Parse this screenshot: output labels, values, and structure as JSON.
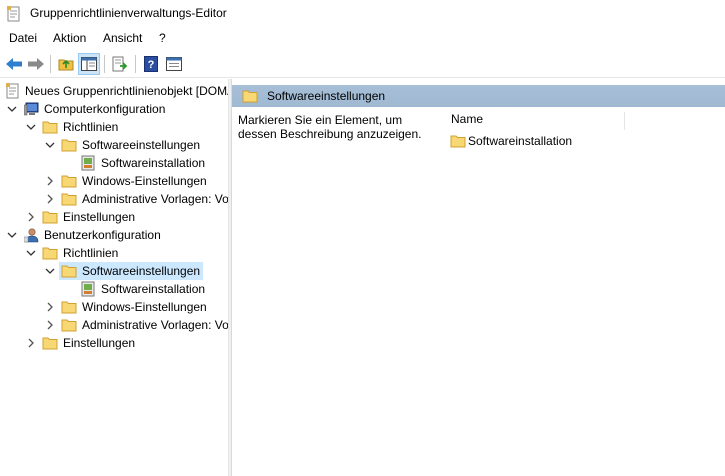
{
  "window": {
    "title": "Gruppenrichtlinienverwaltungs-Editor"
  },
  "menu": {
    "items": [
      "Datei",
      "Aktion",
      "Ansicht",
      "?"
    ]
  },
  "toolbar": {
    "buttons": [
      "back-arrow-icon",
      "forward-arrow-icon",
      "up-folder-icon",
      "show-hide-tree-icon",
      "export-list-icon",
      "help-icon",
      "properties-icon"
    ]
  },
  "tree": {
    "items": [
      {
        "label": "Neues Gruppenrichtlinienobjekt [DOMAIN",
        "level": 0,
        "expanded": true,
        "icon": "policy-document-icon"
      },
      {
        "label": "Computerkonfiguration",
        "level": 1,
        "expanded": true,
        "icon": "computer-icon"
      },
      {
        "label": "Richtlinien",
        "level": 2,
        "expanded": true,
        "icon": "folder-icon"
      },
      {
        "label": "Softwareeinstellungen",
        "level": 3,
        "expanded": true,
        "icon": "folder-icon"
      },
      {
        "label": "Softwareinstallation",
        "level": 4,
        "expanded": null,
        "icon": "software-installation-icon"
      },
      {
        "label": "Windows-Einstellungen",
        "level": 3,
        "expanded": false,
        "icon": "folder-icon"
      },
      {
        "label": "Administrative Vorlagen: Vo",
        "level": 3,
        "expanded": false,
        "icon": "folder-icon"
      },
      {
        "label": "Einstellungen",
        "level": 2,
        "expanded": false,
        "icon": "folder-icon"
      },
      {
        "label": "Benutzerkonfiguration",
        "level": 1,
        "expanded": true,
        "icon": "user-icon"
      },
      {
        "label": "Richtlinien",
        "level": 2,
        "expanded": true,
        "icon": "folder-icon"
      },
      {
        "label": "Softwareeinstellungen",
        "level": 3,
        "expanded": true,
        "icon": "folder-icon",
        "selected": true
      },
      {
        "label": "Softwareinstallation",
        "level": 4,
        "expanded": null,
        "icon": "software-installation-icon"
      },
      {
        "label": "Windows-Einstellungen",
        "level": 3,
        "expanded": false,
        "icon": "folder-icon"
      },
      {
        "label": "Administrative Vorlagen: Vo",
        "level": 3,
        "expanded": false,
        "icon": "folder-icon"
      },
      {
        "label": "Einstellungen",
        "level": 2,
        "expanded": false,
        "icon": "folder-icon"
      }
    ]
  },
  "details": {
    "header_title": "Softwareeinstellungen",
    "description": "Markieren Sie ein Element, um dessen Beschreibung anzuzeigen.",
    "column_name": "Name",
    "items": [
      {
        "label": "Softwareinstallation",
        "icon": "folder-icon"
      }
    ]
  },
  "colors": {
    "header_band": "#a6bed6",
    "selection": "#cce8ff",
    "folder": "#f8d775"
  }
}
